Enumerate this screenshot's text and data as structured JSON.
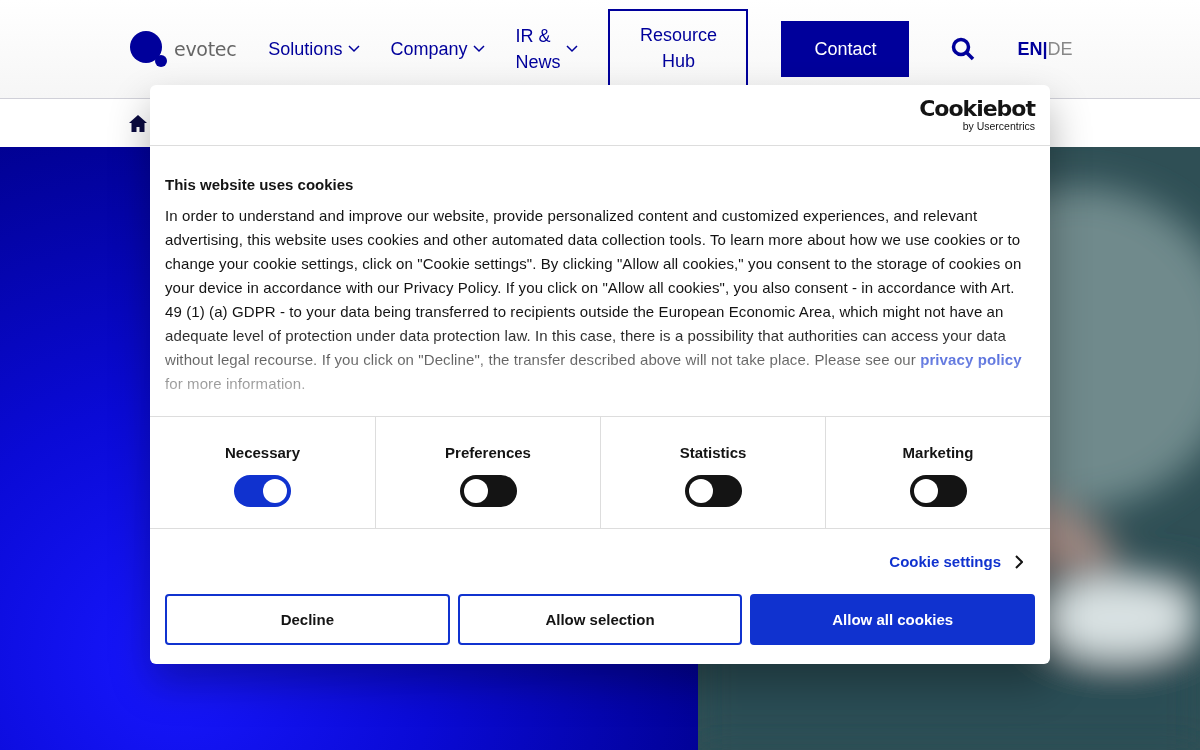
{
  "header": {
    "logo": "evotec",
    "nav": [
      {
        "label": "Solutions",
        "dropdown": true
      },
      {
        "label": "Company",
        "dropdown": true
      },
      {
        "label": "IR & News",
        "dropdown": true
      }
    ],
    "resource_hub": "Resource Hub",
    "contact": "Contact",
    "languages": [
      {
        "label": "EN",
        "selected": true
      },
      {
        "label": "DE",
        "selected": false
      }
    ],
    "language_separator": "|"
  },
  "cookie_dialog": {
    "brand": "Cookiebot",
    "brand_byline": "by Usercentrics",
    "title": "This website uses cookies",
    "body": {
      "before": "In order to understand and improve our website, provide personalized content and customized experiences, and relevant advertising, this website uses cookies and other automated data collection tools. To learn more about how we use cookies or to change your cookie settings, click on \"Cookie settings\". By clicking \"Allow all cookies,\" you consent to the storage of cookies on your device in accordance with our Privacy Policy. If you click on \"Allow all cookies\", you also consent - in accordance with Art. 49 (1) (a) GDPR - to your data being transferred to recipients outside the European Economic Area, which might not have an adequate level of protection under data protection law. In this case, there is a possibility that authorities can access your data without legal recourse. If you click on \"Decline\", the transfer described above will not take place. Please see our",
      "link": "privacy policy",
      "after": "for more information."
    },
    "categories": [
      {
        "label": "Necessary",
        "on": true
      },
      {
        "label": "Preferences",
        "on": false
      },
      {
        "label": "Statistics",
        "on": false
      },
      {
        "label": "Marketing",
        "on": false
      }
    ],
    "settings_link": "Cookie settings",
    "buttons": [
      {
        "label": "Decline",
        "kind": "outline"
      },
      {
        "label": "Allow selection",
        "kind": "outline"
      },
      {
        "label": "Allow all cookies",
        "kind": "primary"
      }
    ]
  }
}
